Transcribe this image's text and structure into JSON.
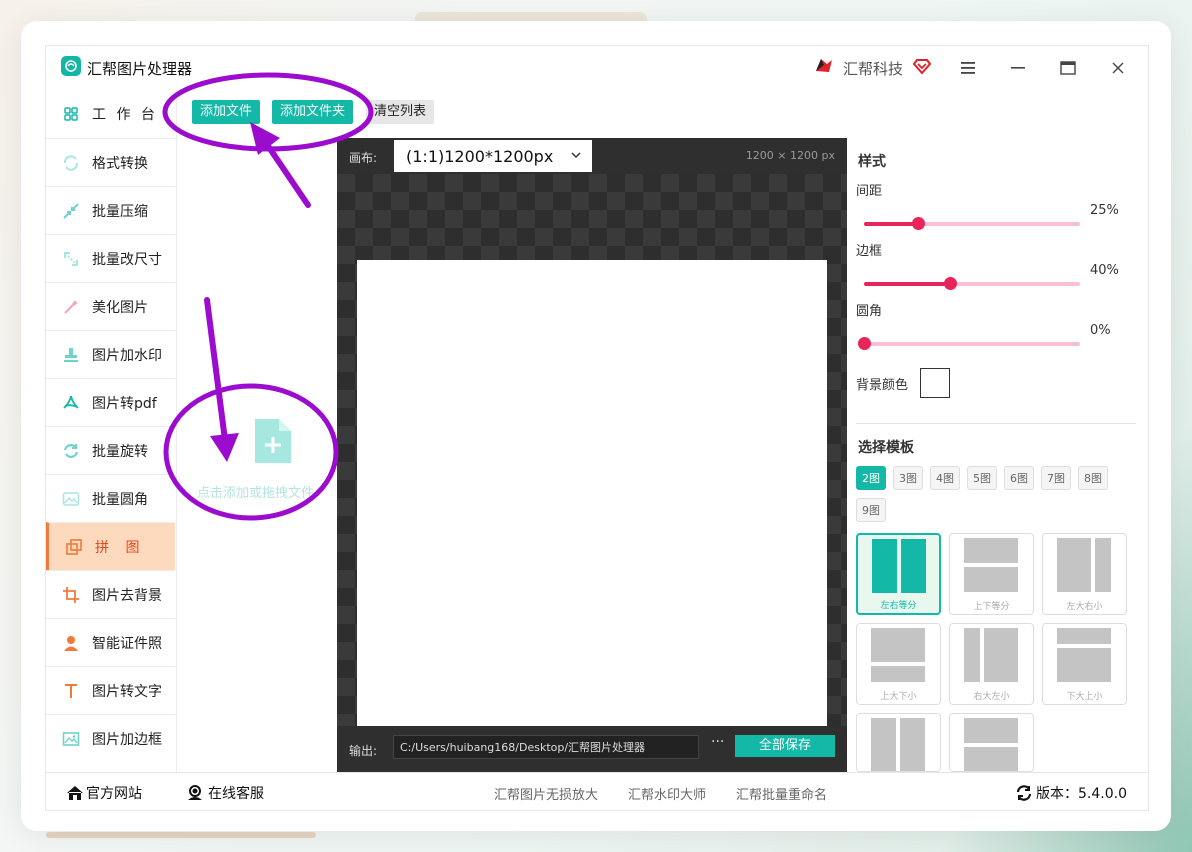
{
  "app": {
    "title": "汇帮图片处理器",
    "brand": "汇帮科技"
  },
  "sidebar": {
    "items": [
      {
        "label": "工 作 台",
        "icon": "grid-icon"
      },
      {
        "label": "格式转换",
        "icon": "convert-icon"
      },
      {
        "label": "批量压缩",
        "icon": "compress-icon"
      },
      {
        "label": "批量改尺寸",
        "icon": "resize-icon"
      },
      {
        "label": "美化图片",
        "icon": "beautify-icon"
      },
      {
        "label": "图片加水印",
        "icon": "stamp-icon"
      },
      {
        "label": "图片转pdf",
        "icon": "pdf-icon"
      },
      {
        "label": "批量旋转",
        "icon": "rotate-icon"
      },
      {
        "label": "批量圆角",
        "icon": "image-icon"
      },
      {
        "label": "拼 图",
        "icon": "collage-icon",
        "active": true
      },
      {
        "label": "图片去背景",
        "icon": "crop-icon"
      },
      {
        "label": "智能证件照",
        "icon": "person-icon"
      },
      {
        "label": "图片转文字",
        "icon": "text-icon"
      },
      {
        "label": "图片加边框",
        "icon": "frame-icon"
      }
    ]
  },
  "toolbar": {
    "add_file": "添加文件",
    "add_folder": "添加文件夹",
    "clear_list": "清空列表"
  },
  "drop": {
    "text": "点击添加或拖拽文件"
  },
  "canvas": {
    "label": "画布:",
    "selected": "(1:1)1200*1200px",
    "size": "1200 × 1200 px",
    "output_label": "输出:",
    "output_path": "C:/Users/huibang168/Desktop/汇帮图片处理器",
    "more": "···",
    "save_all": "全部保存"
  },
  "style": {
    "title": "样式",
    "sliders": [
      {
        "label": "间距",
        "value": 25,
        "display": "25%"
      },
      {
        "label": "边框",
        "value": 40,
        "display": "40%"
      },
      {
        "label": "圆角",
        "value": 0,
        "display": "0%"
      }
    ],
    "bg_color_label": "背景颜色",
    "bg_color": "#ffffff"
  },
  "templates": {
    "title": "选择模板",
    "counts": [
      "2图",
      "3图",
      "4图",
      "5图",
      "6图",
      "7图",
      "8图",
      "9图"
    ],
    "active_count": "2图",
    "cards": [
      "左右等分",
      "上下等分",
      "左大右小",
      "上大下小",
      "右大左小",
      "下大上小",
      "",
      ""
    ],
    "active_card": "左右等分"
  },
  "footer": {
    "website": "官方网站",
    "service": "在线客服",
    "links": [
      "汇帮图片无损放大",
      "汇帮水印大师",
      "汇帮批量重命名"
    ],
    "version": "版本：5.4.0.0"
  },
  "colors": {
    "accent": "#14b8a6",
    "active_bg": "#fdd9bd",
    "active_text": "#e8491d",
    "slider": "#e8245b",
    "annotation": "#9b0ccf"
  }
}
